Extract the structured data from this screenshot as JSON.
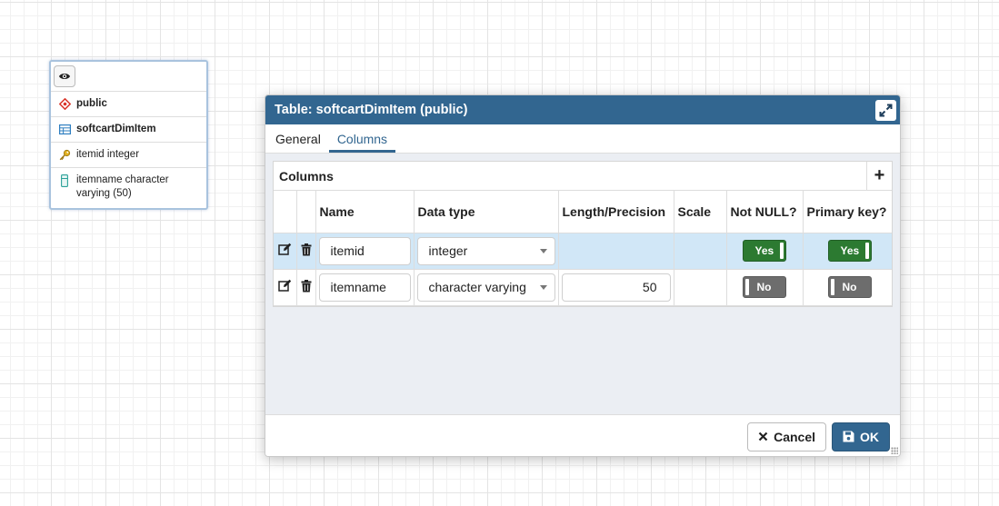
{
  "erd_node": {
    "schema": "public",
    "table": "softcartDimItem",
    "columns": [
      {
        "label": "itemid integer",
        "icon": "key-icon"
      },
      {
        "label": "itemname character varying (50)",
        "icon": "column-icon"
      }
    ]
  },
  "dialog": {
    "title": "Table: softcartDimItem (public)",
    "tabs": [
      {
        "label": "General",
        "active": false
      },
      {
        "label": "Columns",
        "active": true
      }
    ],
    "panel_title": "Columns",
    "headers": [
      "Name",
      "Data type",
      "Length/Precision",
      "Scale",
      "Not NULL?",
      "Primary key?"
    ],
    "rows": [
      {
        "name": "itemid",
        "data_type": "integer",
        "length": "",
        "scale": "",
        "not_null": "Yes",
        "primary_key": "Yes"
      },
      {
        "name": "itemname",
        "data_type": "character varying",
        "length": "50",
        "scale": "",
        "not_null": "No",
        "primary_key": "No"
      }
    ],
    "cancel_label": "Cancel",
    "ok_label": "OK"
  },
  "colors": {
    "header": "#326690",
    "toggle_on": "#2c7a31",
    "toggle_off": "#6d6d6d",
    "selected_row": "#d1e7f7"
  }
}
